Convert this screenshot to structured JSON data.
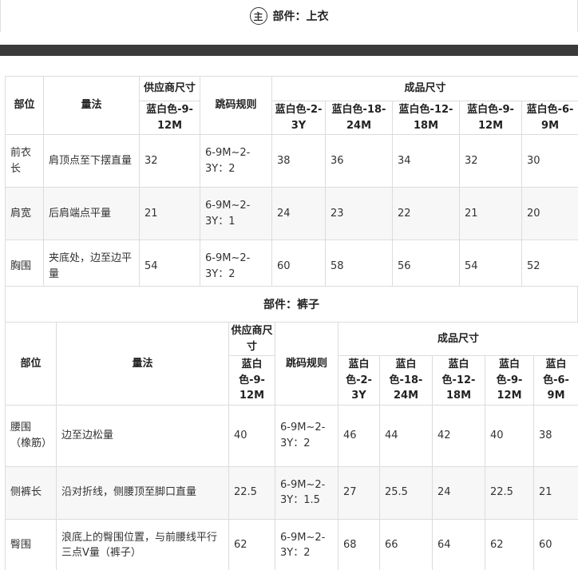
{
  "header": {
    "badge": "主",
    "title": "部件：上衣"
  },
  "top": {
    "headers": {
      "part": "部位",
      "method": "量法",
      "supplier": "供应商尺寸",
      "supplier_size": "蓝白色-9-12M",
      "rule": "跳码规则",
      "finished": "成品尺寸",
      "sizes": [
        "蓝白色-2-3Y",
        "蓝白色-18-24M",
        "蓝白色-12-18M",
        "蓝白色-9-12M",
        "蓝白色-6-9M"
      ]
    },
    "rows": [
      {
        "part": "前衣长",
        "method": "肩顶点至下摆直量",
        "supplier": "32",
        "rule": "6-9M~2-3Y：2",
        "values": [
          "38",
          "36",
          "34",
          "32",
          "30"
        ]
      },
      {
        "part": "肩宽",
        "method": "后肩端点平量",
        "supplier": "21",
        "rule": "6-9M~2-3Y：1",
        "values": [
          "24",
          "23",
          "22",
          "21",
          "20"
        ]
      },
      {
        "part": "胸围",
        "method": "夹底处，边至边平量",
        "supplier": "54",
        "rule": "6-9M~2-3Y：2",
        "values": [
          "60",
          "58",
          "56",
          "54",
          "52"
        ]
      }
    ]
  },
  "bottom": {
    "title": "部件：裤子",
    "headers": {
      "part": "部位",
      "method": "量法",
      "supplier": "供应商尺寸",
      "supplier_size": "蓝白色-9-12M",
      "rule": "跳码规则",
      "finished": "成品尺寸",
      "sizes": [
        "蓝白色-2-3Y",
        "蓝白色-18-24M",
        "蓝白色-12-18M",
        "蓝白色-9-12M",
        "蓝白色-6-9M"
      ]
    },
    "rows": [
      {
        "part": "腰围（橡筋）",
        "method": "边至边松量",
        "supplier": "40",
        "rule": "6-9M~2-3Y：2",
        "values": [
          "46",
          "44",
          "42",
          "40",
          "38"
        ]
      },
      {
        "part": "侧裤长",
        "method": "沿对折线，侧腰顶至脚口直量",
        "supplier": "22.5",
        "rule": "6-9M~2-3Y：1.5",
        "values": [
          "27",
          "25.5",
          "24",
          "22.5",
          "21"
        ]
      },
      {
        "part": "臀围",
        "method": "浪底上的臀围位置，与前腰线平行三点V量（裤子）",
        "supplier": "62",
        "rule": "6-9M~2-3Y：2",
        "values": [
          "68",
          "66",
          "64",
          "62",
          "60"
        ]
      }
    ]
  }
}
